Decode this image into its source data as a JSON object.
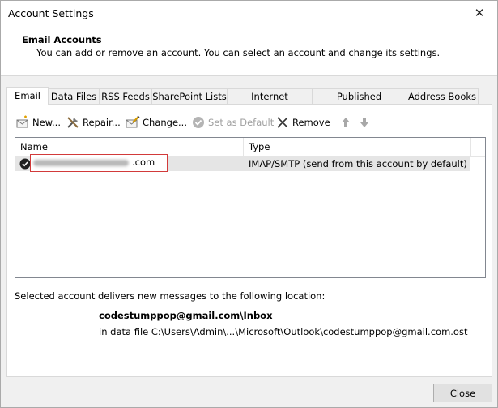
{
  "window": {
    "title": "Account Settings"
  },
  "header": {
    "title": "Email Accounts",
    "description": "You can add or remove an account. You can select an account and change its settings."
  },
  "tabs": [
    {
      "label": "Email",
      "active": true
    },
    {
      "label": "Data Files"
    },
    {
      "label": "RSS Feeds"
    },
    {
      "label": "SharePoint Lists"
    },
    {
      "label": "Internet Calendars"
    },
    {
      "label": "Published Calendars"
    },
    {
      "label": "Address Books"
    }
  ],
  "toolbar": {
    "new_label": "New...",
    "repair_label": "Repair...",
    "change_label": "Change...",
    "set_default_label": "Set as Default",
    "remove_label": "Remove"
  },
  "list": {
    "columns": [
      "Name",
      "Type"
    ],
    "rows": [
      {
        "name_suffix": ".com",
        "type": "IMAP/SMTP (send from this account by default)"
      }
    ]
  },
  "delivery": {
    "text": "Selected account delivers new messages to the following location:",
    "folder": "codestumppop@gmail.com\\Inbox",
    "data_file": "in data file C:\\Users\\Admin\\...\\Microsoft\\Outlook\\codestumppop@gmail.com.ost"
  },
  "footer": {
    "close_label": "Close"
  },
  "colors": {
    "selection_highlight": "#e5e5e5",
    "redaction_border": "#d23a3a"
  }
}
